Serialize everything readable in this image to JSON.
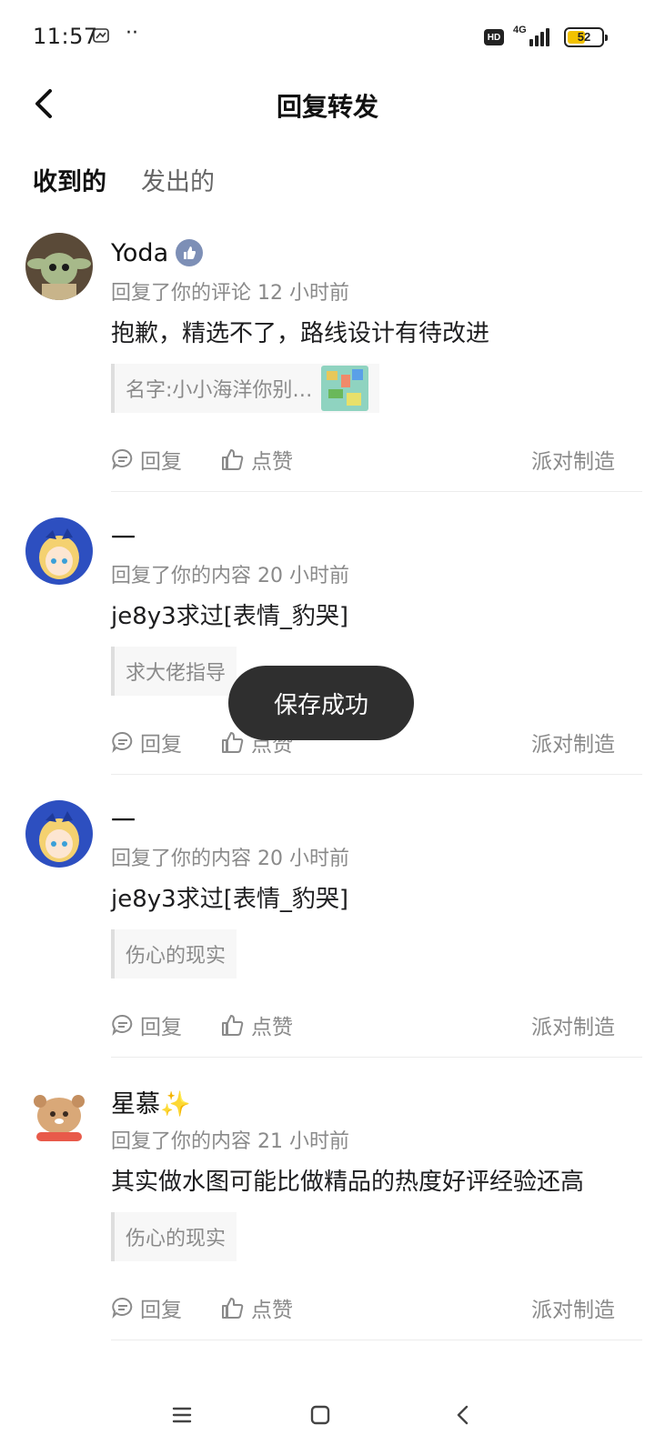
{
  "status_bar": {
    "time": "11:57",
    "dots": "··",
    "hd": "HD",
    "network": "4G",
    "battery": "52",
    "battery_level": 0.52,
    "battery_color": "#f2c200"
  },
  "header": {
    "title": "回复转发",
    "back_icon": "chevron-left-icon"
  },
  "tabs": [
    {
      "label": "收到的",
      "active": true
    },
    {
      "label": "发出的",
      "active": false
    }
  ],
  "accent_color": "#2ed8c3",
  "items": [
    {
      "name": "Yoda",
      "meta": "回复了你的评论 12 小时前",
      "body": "抱歉，精选不了，路线设计有待改进",
      "quote": "名字:小小海洋你别…",
      "reply": "回复",
      "like": "点赞",
      "source": "派对制造"
    },
    {
      "name": "一",
      "meta": "回复了你的内容 20 小时前",
      "body": "je8y3求过[表情_豹哭]",
      "quote": "求大佬指导",
      "reply": "回复",
      "like": "点赞",
      "source": "派对制造"
    },
    {
      "name": "一",
      "meta": "回复了你的内容 20 小时前",
      "body": "je8y3求过[表情_豹哭]",
      "quote": "伤心的现实",
      "reply": "回复",
      "like": "点赞",
      "source": "派对制造"
    },
    {
      "name": "星慕✨",
      "meta": "回复了你的内容 21 小时前",
      "body": "其实做水图可能比做精品的热度好评经验还高",
      "quote": "伤心的现实",
      "reply": "回复",
      "like": "点赞",
      "source": "派对制造"
    }
  ],
  "toast": "保存成功",
  "nav": {
    "menu_icon": "menu-icon",
    "home_icon": "home-square-icon",
    "back_icon": "back-triangle-icon"
  }
}
